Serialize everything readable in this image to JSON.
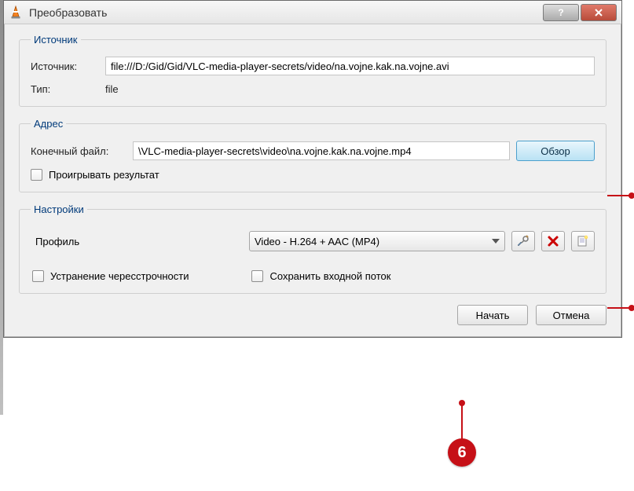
{
  "title": "Преобразовать",
  "source": {
    "legend": "Источник",
    "src_label": "Источник:",
    "src_value": "file:///D:/Gid/Gid/VLC-media-player-secrets/video/na.vojne.kak.na.vojne.avi",
    "type_label": "Тип:",
    "type_value": "file"
  },
  "destination": {
    "legend": "Адрес",
    "dest_label": "Конечный файл:",
    "dest_value": "\\VLC-media-player-secrets\\video\\na.vojne.kak.na.vojne.mp4",
    "browse_label": "Обзор",
    "play_result_label": "Проигрывать результат"
  },
  "settings": {
    "legend": "Настройки",
    "profile_label": "Профиль",
    "profile_selected": "Video - H.264 + AAC (MP4)",
    "deinterlace_label": "Устранение чересстрочности",
    "keep_input_label": "Сохранить входной поток"
  },
  "footer": {
    "start_label": "Начать",
    "cancel_label": "Отмена"
  },
  "icons": {
    "tools": "tools-icon",
    "delete": "delete-icon",
    "new": "new-profile-icon"
  },
  "annotation": {
    "callout_number": "6"
  }
}
